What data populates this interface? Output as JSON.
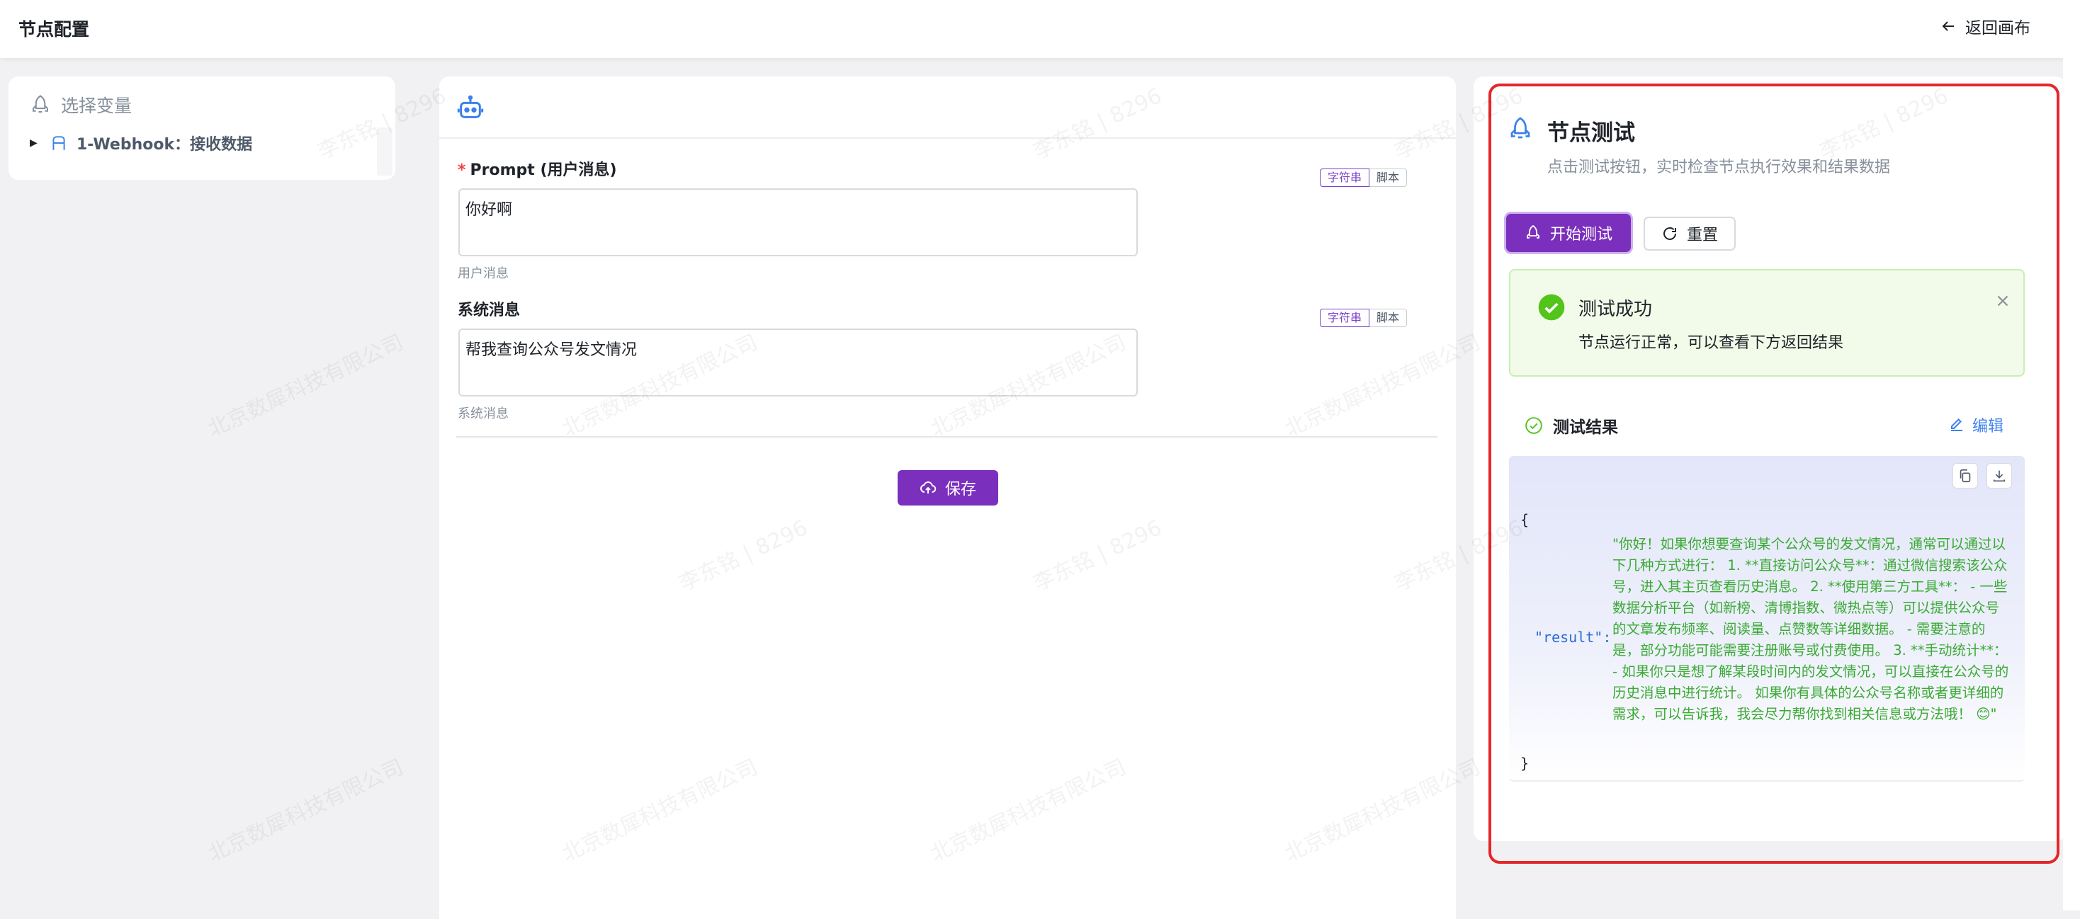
{
  "header": {
    "title": "节点配置",
    "back_label": "返回画布"
  },
  "variables": {
    "title": "选择变量",
    "items": [
      {
        "label": "1-Webhook：接收数据"
      }
    ]
  },
  "editor": {
    "prompt": {
      "label": "Prompt (用户消息)",
      "required_mark": "*",
      "tag_string": "字符串",
      "tag_script": "脚本",
      "value": "你好啊",
      "hint": "用户消息"
    },
    "system": {
      "label": "系统消息",
      "tag_string": "字符串",
      "tag_script": "脚本",
      "value": "帮我查询公众号发文情况",
      "hint": "系统消息"
    },
    "save_label": "保存"
  },
  "test_panel": {
    "title": "节点测试",
    "subtitle": "点击测试按钮，实时检查节点执行效果和结果数据",
    "start_label": "开始测试",
    "reset_label": "重置",
    "alert": {
      "title": "测试成功",
      "description": "节点运行正常，可以查看下方返回结果"
    },
    "result": {
      "title": "测试结果",
      "edit_label": "编辑",
      "open_brace": "{",
      "close_brace": "}",
      "key": "\"result\":",
      "value": "\"你好！如果你想要查询某个公众号的发文情况，通常可以通过以下几种方式进行： 1. **直接访问公众号**：通过微信搜索该公众号，进入其主页查看历史消息。 2. **使用第三方工具**： - 一些数据分析平台（如新榜、清博指数、微热点等）可以提供公众号的文章发布频率、阅读量、点赞数等详细数据。 - 需要注意的是，部分功能可能需要注册账号或付费使用。 3. **手动统计**： - 如果你只是想了解某段时间内的发文情况，可以直接在公众号的历史消息中进行统计。 如果你有具体的公众号名称或者更详细的需求，可以告诉我，我会尽力帮你找到相关信息或方法哦！ 😊\""
    }
  },
  "watermark": {
    "name": "李东铭 | 8296",
    "company": "北京数犀科技有限公司"
  },
  "colors": {
    "accent": "#7b2fbd",
    "success": "#52c41a",
    "link": "#3b7ff0",
    "highlight_frame": "#e5262a"
  }
}
